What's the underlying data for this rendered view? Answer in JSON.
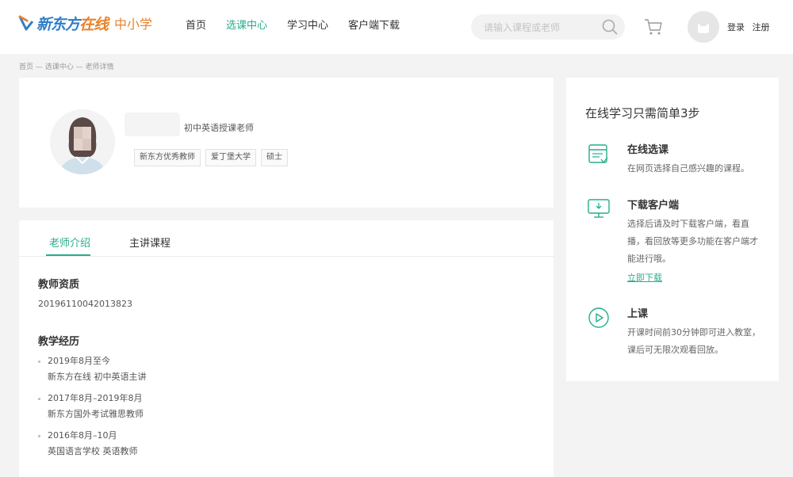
{
  "brand": {
    "name_main": "新东方",
    "name_accent": "在线",
    "sub": "中小学",
    "color_primary": "#2f7ec8",
    "color_accent": "#e8822c"
  },
  "theme": {
    "accent": "#27ad8e"
  },
  "nav": {
    "items": [
      "首页",
      "选课中心",
      "学习中心",
      "客户端下载"
    ],
    "active_index": 1
  },
  "search": {
    "placeholder": "请输入课程或老师"
  },
  "auth": {
    "login": "登录",
    "register": "注册"
  },
  "breadcrumb": "首页 — 选课中心 — 老师详情",
  "teacher": {
    "subject": "初中英语授课老师",
    "tags": [
      "新东方优秀教师",
      "爱丁堡大学",
      "硕士"
    ]
  },
  "tabs": [
    {
      "label": "老师介绍",
      "active": true
    },
    {
      "label": "主讲课程",
      "active": false
    }
  ],
  "qualification": {
    "title": "教师资质",
    "value": "20196110042013823"
  },
  "experience": {
    "title": "教学经历",
    "items": [
      {
        "period": "2019年8月至今",
        "detail": "新东方在线 初中英语主讲"
      },
      {
        "period": "2017年8月–2019年8月",
        "detail": "新东方国外考试雅思教师"
      },
      {
        "period": "2016年8月–10月",
        "detail": "英国语言学校 英语教师"
      }
    ]
  },
  "steps": {
    "title": "在线学习只需简单3步",
    "items": [
      {
        "title": "在线选课",
        "desc": "在网页选择自己感兴趣的课程。",
        "icon": "course-select-icon"
      },
      {
        "title": "下载客户端",
        "desc": "选择后请及时下载客户端，看直播，看回放等更多功能在客户端才能进行哦。",
        "icon": "monitor-icon",
        "link": "立即下载"
      },
      {
        "title": "上课",
        "desc": "开课时间前30分钟即可进入教室，课后可无限次观看回放。",
        "icon": "play-icon"
      }
    ]
  }
}
